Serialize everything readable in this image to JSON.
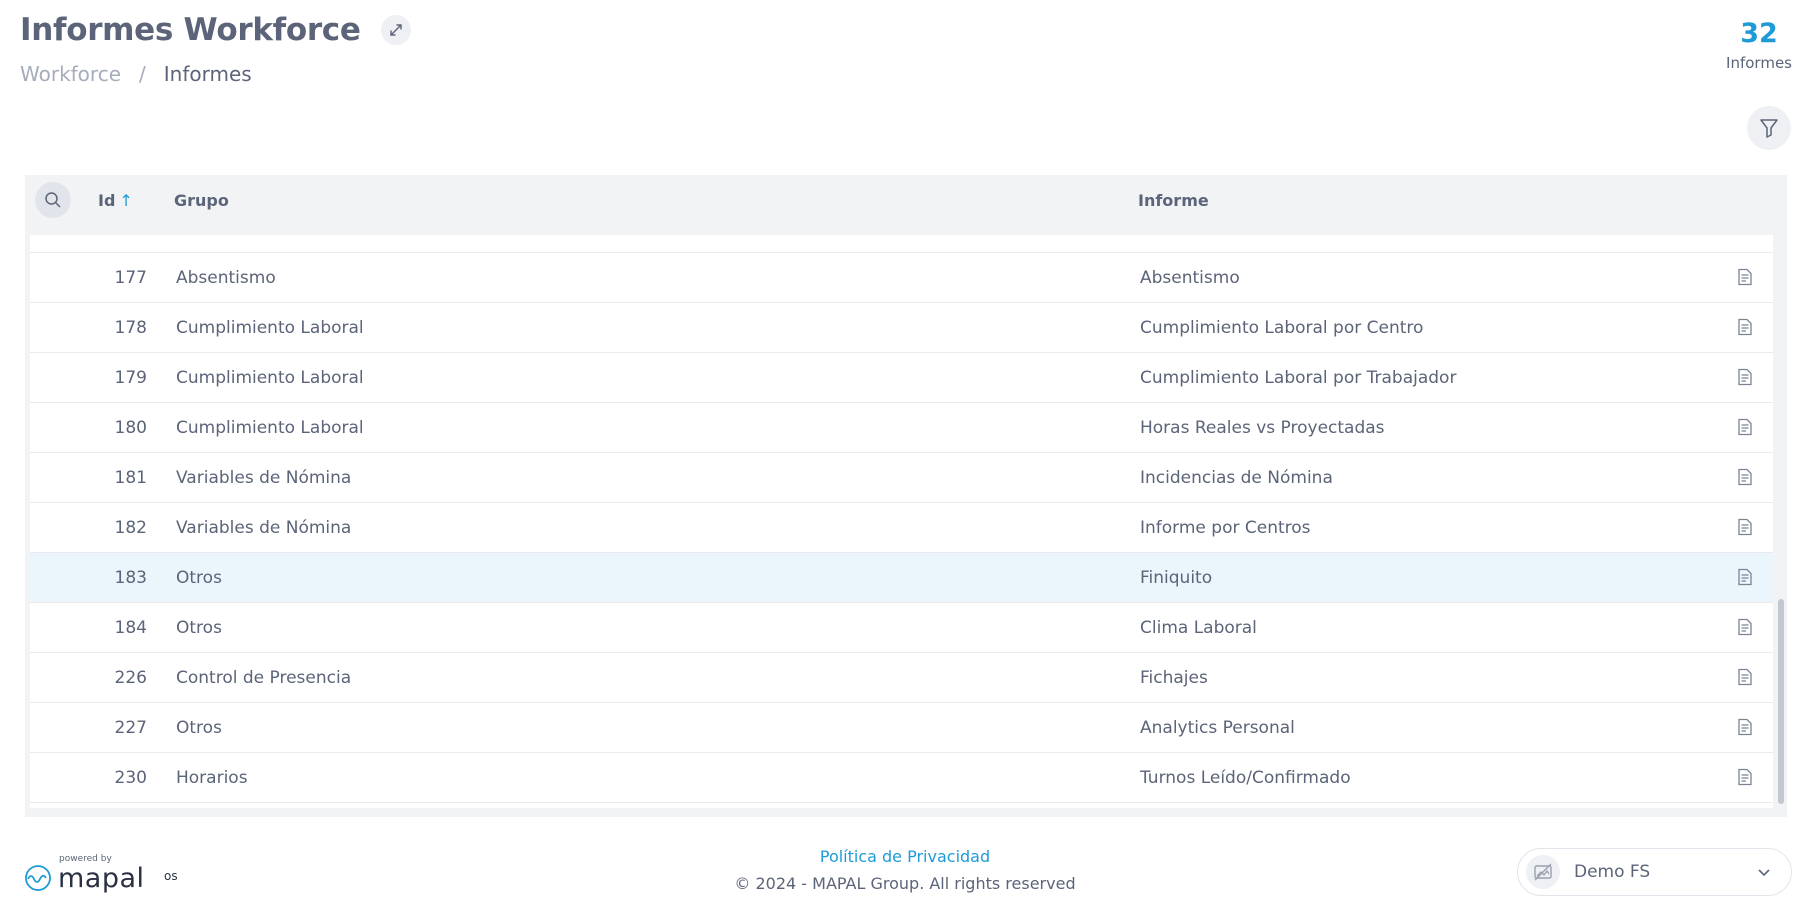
{
  "header": {
    "title": "Informes Workforce",
    "breadcrumb": {
      "root": "Workforce",
      "separator": "/",
      "current": "Informes"
    }
  },
  "counter": {
    "value": "32",
    "label": "Informes"
  },
  "table": {
    "columns": {
      "id": "Id",
      "id_sort": "↑",
      "grupo": "Grupo",
      "informe": "Informe"
    },
    "rows": [
      {
        "id": "177",
        "grupo": "Absentismo",
        "informe": "Absentismo",
        "selected": false
      },
      {
        "id": "178",
        "grupo": "Cumplimiento Laboral",
        "informe": "Cumplimiento Laboral por Centro",
        "selected": false
      },
      {
        "id": "179",
        "grupo": "Cumplimiento Laboral",
        "informe": "Cumplimiento Laboral por Trabajador",
        "selected": false
      },
      {
        "id": "180",
        "grupo": "Cumplimiento Laboral",
        "informe": "Horas Reales vs Proyectadas",
        "selected": false
      },
      {
        "id": "181",
        "grupo": "Variables de Nómina",
        "informe": "Incidencias de Nómina",
        "selected": false
      },
      {
        "id": "182",
        "grupo": "Variables de Nómina",
        "informe": "Informe por Centros",
        "selected": false
      },
      {
        "id": "183",
        "grupo": "Otros",
        "informe": "Finiquito",
        "selected": true
      },
      {
        "id": "184",
        "grupo": "Otros",
        "informe": "Clima Laboral",
        "selected": false
      },
      {
        "id": "226",
        "grupo": "Control de Presencia",
        "informe": "Fichajes",
        "selected": false
      },
      {
        "id": "227",
        "grupo": "Otros",
        "informe": "Analytics Personal",
        "selected": false
      },
      {
        "id": "230",
        "grupo": "Horarios",
        "informe": "Turnos Leído/Confirmado",
        "selected": false
      }
    ]
  },
  "footer": {
    "privacy": "Política de Privacidad",
    "copyright": "© 2024 - MAPAL Group. All rights reserved",
    "logo": {
      "powered": "powered by",
      "word": "mapal",
      "suffix": "os"
    },
    "company": "Demo FS"
  },
  "colors": {
    "accent": "#1e9bd7",
    "text": "#5b6478",
    "selected_row": "#eaf5fc",
    "panel": "#f2f3f5"
  },
  "icons": {
    "expand": "expand-arrows-icon",
    "filter": "filter-funnel-icon",
    "search": "search-icon",
    "row_action": "report-document-icon",
    "company": "image-placeholder-icon",
    "dropdown": "chevron-down-icon"
  }
}
